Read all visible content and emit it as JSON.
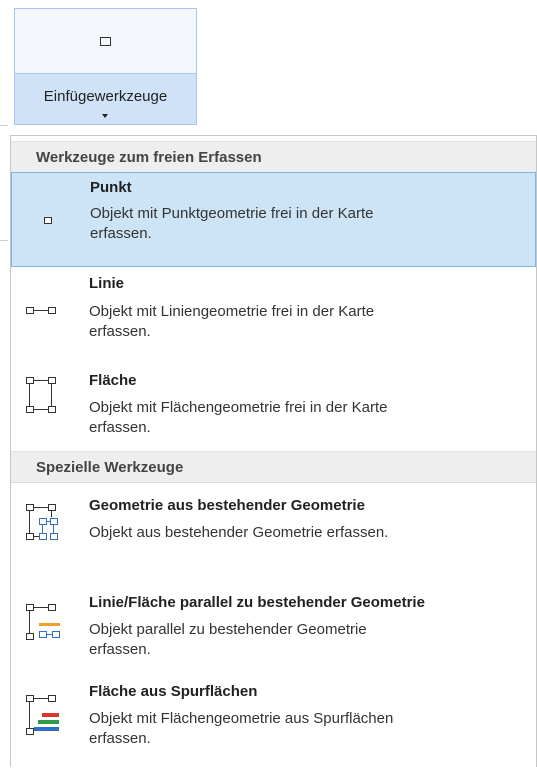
{
  "ribbon": {
    "button_label": "Einfügewerkzeuge",
    "icon": "point-square-icon"
  },
  "menu": {
    "sections": [
      {
        "header": "Werkzeuge zum freien Erfassen",
        "items": [
          {
            "title": "Punkt",
            "desc1": "Objekt mit Punktgeometrie frei in der Karte",
            "desc2": "erfassen.",
            "icon": "point-icon",
            "selected": true
          },
          {
            "title": "Linie",
            "desc1": "Objekt mit Liniengeometrie frei in der Karte",
            "desc2": "erfassen.",
            "icon": "line-icon",
            "selected": false
          },
          {
            "title": "Fläche",
            "desc1": "Objekt mit Flächengeometrie frei in der Karte",
            "desc2": "erfassen.",
            "icon": "polygon-icon",
            "selected": false
          }
        ]
      },
      {
        "header": "Spezielle Werkzeuge",
        "items": [
          {
            "title": "Geometrie aus bestehender Geometrie",
            "desc1": "Objekt aus bestehender Geometrie erfassen.",
            "icon": "geometry-from-existing-icon"
          },
          {
            "title": "Linie/Fläche parallel zu bestehender Geometrie",
            "desc1": "Objekt parallel zu bestehender Geometrie",
            "desc2": "erfassen.",
            "icon": "parallel-geometry-icon"
          },
          {
            "title": "Fläche aus Spurflächen",
            "desc1": "Objekt mit Flächengeometrie aus Spurflächen",
            "desc2": "erfassen.",
            "icon": "area-from-lanes-icon"
          }
        ]
      }
    ]
  },
  "colors": {
    "selected_bg": "#cde4f7",
    "selected_border": "#7eb4ea",
    "ribbon_dropdown_bg": "#cfe2f7",
    "accent_orange": "#f0a030",
    "accent_red": "#d9362b",
    "accent_green": "#2e9c4a",
    "accent_blue": "#2f6fc4"
  }
}
